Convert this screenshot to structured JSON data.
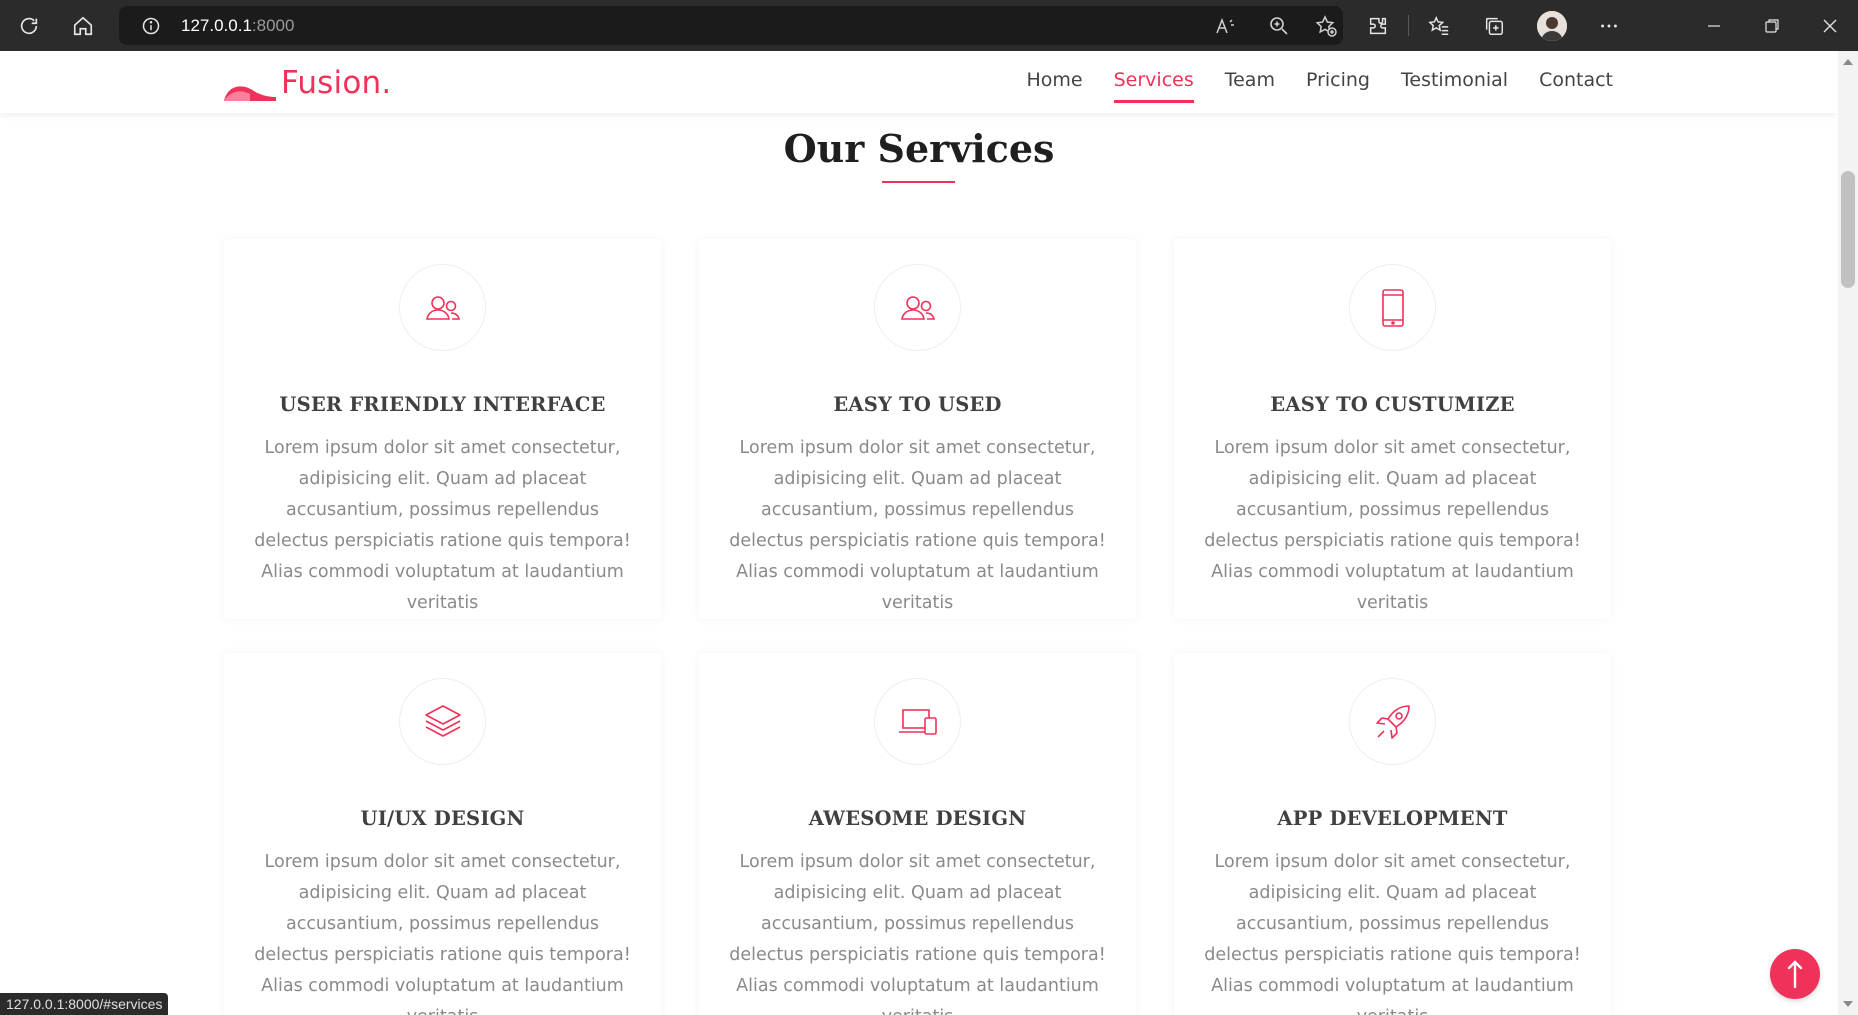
{
  "browser": {
    "url_host": "127.0.0.1",
    "url_port": ":8000",
    "status_url": "127.0.0.1:8000/#services"
  },
  "header": {
    "logo_text": "Fusion.",
    "nav": [
      {
        "label": "Home"
      },
      {
        "label": "Services"
      },
      {
        "label": "Team"
      },
      {
        "label": "Pricing"
      },
      {
        "label": "Testimonial"
      },
      {
        "label": "Contact"
      }
    ],
    "active_nav": "Services"
  },
  "services": {
    "title": "Our Services",
    "cards": [
      {
        "icon": "users-icon",
        "title": "USER FRIENDLY INTERFACE",
        "text": "Lorem ipsum dolor sit amet consectetur, adipisicing elit. Quam ad placeat accusantium, possimus repellendus delectus perspiciatis ratione quis tempora! Alias commodi voluptatum at laudantium veritatis"
      },
      {
        "icon": "users-icon",
        "title": "EASY TO USED",
        "text": "Lorem ipsum dolor sit amet consectetur, adipisicing elit. Quam ad placeat accusantium, possimus repellendus delectus perspiciatis ratione quis tempora! Alias commodi voluptatum at laudantium veritatis"
      },
      {
        "icon": "smartphone-icon",
        "title": "EASY TO CUSTUMIZE",
        "text": "Lorem ipsum dolor sit amet consectetur, adipisicing elit. Quam ad placeat accusantium, possimus repellendus delectus perspiciatis ratione quis tempora! Alias commodi voluptatum at laudantium veritatis"
      },
      {
        "icon": "layers-icon",
        "title": "UI/UX DESIGN",
        "text": "Lorem ipsum dolor sit amet consectetur, adipisicing elit. Quam ad placeat accusantium, possimus repellendus delectus perspiciatis ratione quis tempora! Alias commodi voluptatum at laudantium veritatis"
      },
      {
        "icon": "devices-icon",
        "title": "AWESOME DESIGN",
        "text": "Lorem ipsum dolor sit amet consectetur, adipisicing elit. Quam ad placeat accusantium, possimus repellendus delectus perspiciatis ratione quis tempora! Alias commodi voluptatum at laudantium veritatis"
      },
      {
        "icon": "rocket-icon",
        "title": "APP DEVELOPMENT",
        "text": "Lorem ipsum dolor sit amet consectetur, adipisicing elit. Quam ad placeat accusantium, possimus repellendus delectus perspiciatis ratione quis tempora! Alias commodi voluptatum at laudantium veritatis"
      }
    ]
  },
  "colors": {
    "accent": "#f0325a",
    "browser_dark": "#2b2b2b"
  }
}
